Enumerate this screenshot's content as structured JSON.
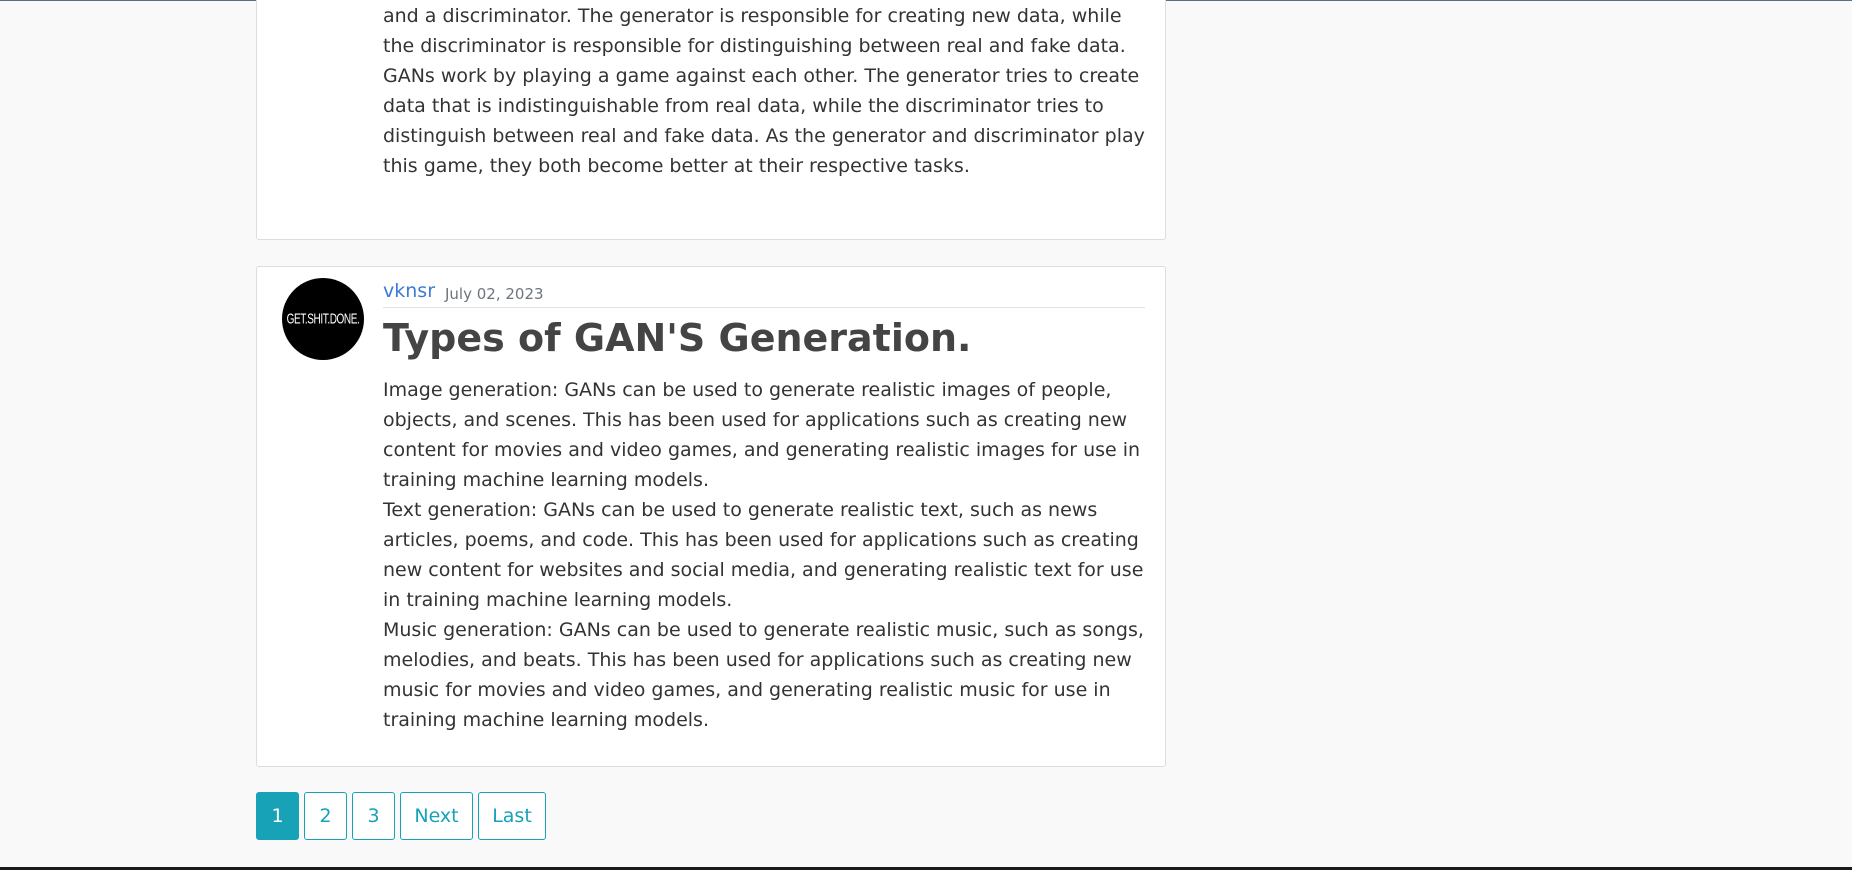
{
  "previous_post": {
    "paragraphs": [
      "and a discriminator. The generator is responsible for creating new data, while the discriminator is responsible for distinguishing between real and fake data.",
      "GANs work by playing a game against each other. The generator tries to create data that is indistinguishable from real data, while the discriminator tries to distinguish between real and fake data. As the generator and discriminator play this game, they both become better at their respective tasks."
    ]
  },
  "post": {
    "avatar_text": "GET.SHIT.DONE.",
    "author": "vknsr",
    "date": "July 02, 2023",
    "title": "Types of GAN'S Generation.",
    "paragraphs": [
      "Image generation: GANs can be used to generate realistic images of people, objects, and scenes. This has been used for applications such as creating new content for movies and video games, and generating realistic images for use in training machine learning models.",
      "Text generation: GANs can be used to generate realistic text, such as news articles, poems, and code. This has been used for applications such as creating new content for websites and social media, and generating realistic text for use in training machine learning models.",
      "Music generation: GANs can be used to generate realistic music, such as songs, melodies, and beats. This has been used for applications such as creating new music for movies and video games, and generating realistic music for use in training machine learning models."
    ]
  },
  "pagination": {
    "pages": [
      "1",
      "2",
      "3"
    ],
    "active": "1",
    "next_label": "Next",
    "last_label": "Last"
  },
  "colors": {
    "accent": "#17a2b8",
    "link": "#3a7bd5",
    "background": "#f9f9f9"
  }
}
